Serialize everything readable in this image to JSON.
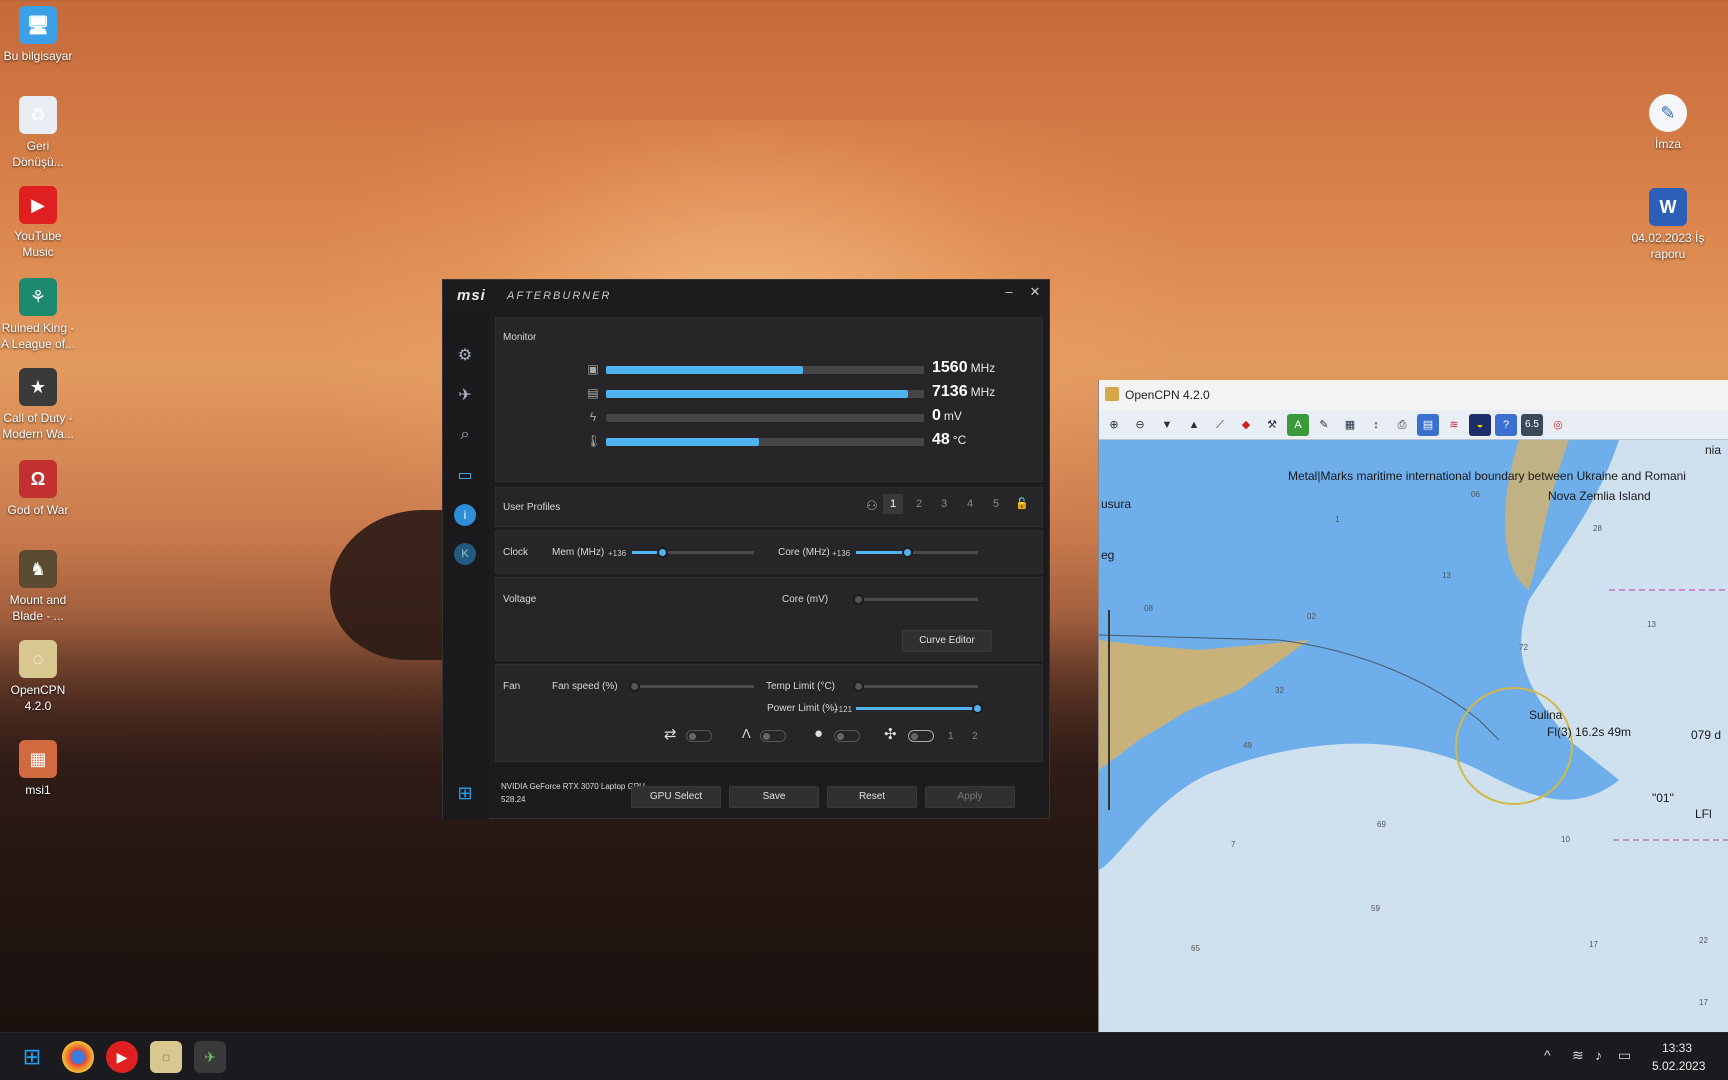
{
  "desktop_icons": [
    {
      "label": "Bu bilgisayar",
      "icon": "pc-icon",
      "color": "#3ba0e8"
    },
    {
      "label": "Geri Dönüşü...",
      "icon": "recycle-bin-icon",
      "color": "#e8eef4"
    },
    {
      "label": "YouTube Music",
      "icon": "youtube-music-icon",
      "color": "#e02020"
    },
    {
      "label": "Ruined King - A League of...",
      "icon": "ruined-king-icon",
      "color": "#1c8a6e"
    },
    {
      "label": "Call of Duty - Modern Wa...",
      "icon": "call-of-duty-icon",
      "color": "#3a3a3a"
    },
    {
      "label": "God of War",
      "icon": "god-of-war-icon",
      "color": "#c23030"
    },
    {
      "label": "Mount and Blade - ...",
      "icon": "mount-and-blade-icon",
      "color": "#5a4a30"
    },
    {
      "label": "OpenCPN 4.2.0",
      "icon": "opencpn-icon",
      "color": "#d8c890"
    },
    {
      "label": "msi1",
      "icon": "image-file-icon",
      "color": "#d26a40"
    }
  ],
  "desktop_right_icons": [
    {
      "label": "İmza",
      "icon": "signature-file-icon"
    },
    {
      "label": "04.02.2023 İş raporu",
      "icon": "word-document-icon"
    }
  ],
  "afterburner": {
    "brand": "msi",
    "product": "AFTERBURNER",
    "minimize": "–",
    "close": "✕",
    "monitor_label": "Monitor",
    "monitor": [
      {
        "icon": "gpu-chip-icon",
        "value": "1560",
        "unit": "MHz",
        "fill": 0.62
      },
      {
        "icon": "memory-icon",
        "value": "7136",
        "unit": "MHz",
        "fill": 0.95
      },
      {
        "icon": "voltage-icon",
        "value": "0",
        "unit": "mV",
        "fill": 0.0
      },
      {
        "icon": "thermometer-icon",
        "value": "48",
        "unit": "°C",
        "fill": 0.48
      }
    ],
    "user_profiles_label": "User Profiles",
    "profiles": [
      "1",
      "2",
      "3",
      "4",
      "5"
    ],
    "clock_label": "Clock",
    "mem_label": "Mem (MHz)",
    "mem_value": "+136",
    "core_label": "Core (MHz)",
    "core_value": "+136",
    "voltage_label": "Voltage",
    "core_mv_label": "Core (mV)",
    "curve_editor": "Curve Editor",
    "fan_label": "Fan",
    "fan_speed_label": "Fan speed (%)",
    "temp_limit_label": "Temp Limit (°C)",
    "power_limit_label": "Power Limit (%)",
    "power_limit_value": "+121",
    "fan_profiles": [
      "1",
      "2"
    ],
    "gpu_name": "NVIDIA GeForce RTX 3070 Laptop GPU",
    "driver": "528.24",
    "gpu_select": "GPU Select",
    "save": "Save",
    "reset": "Reset",
    "apply": "Apply",
    "accent": "#4fb3f0"
  },
  "opencpn": {
    "title": "OpenCPN 4.2.0",
    "scale_badge": "6.5",
    "labels": {
      "boundary": "Metal|Marks maritime international boundary between Ukraine and Romani",
      "nova": "Nova Zemlia Island",
      "sulina": "Sulina",
      "light": "Fl(3) 16.2s 49m",
      "usura": "usura",
      "eg": "eg",
      "o1": "\"01\"",
      "lfl": "LFl",
      "o79": "079 d",
      "nia": "nia"
    },
    "depths": [
      "1",
      "06",
      "13",
      "28",
      "02",
      "08",
      "72",
      "32",
      "13",
      "49",
      "69",
      "7",
      "59",
      "10",
      "17",
      "22",
      "65",
      "17"
    ],
    "colors": {
      "shallow": "#6eaeea",
      "land": "#c9b27a",
      "deep": "#cfe0ef"
    }
  },
  "taskbar": {
    "apps": [
      "start-icon",
      "chrome-icon",
      "youtube-music-icon",
      "opencpn-icon",
      "afterburner-icon"
    ],
    "time": "13:33",
    "date": "5.02.2023"
  }
}
